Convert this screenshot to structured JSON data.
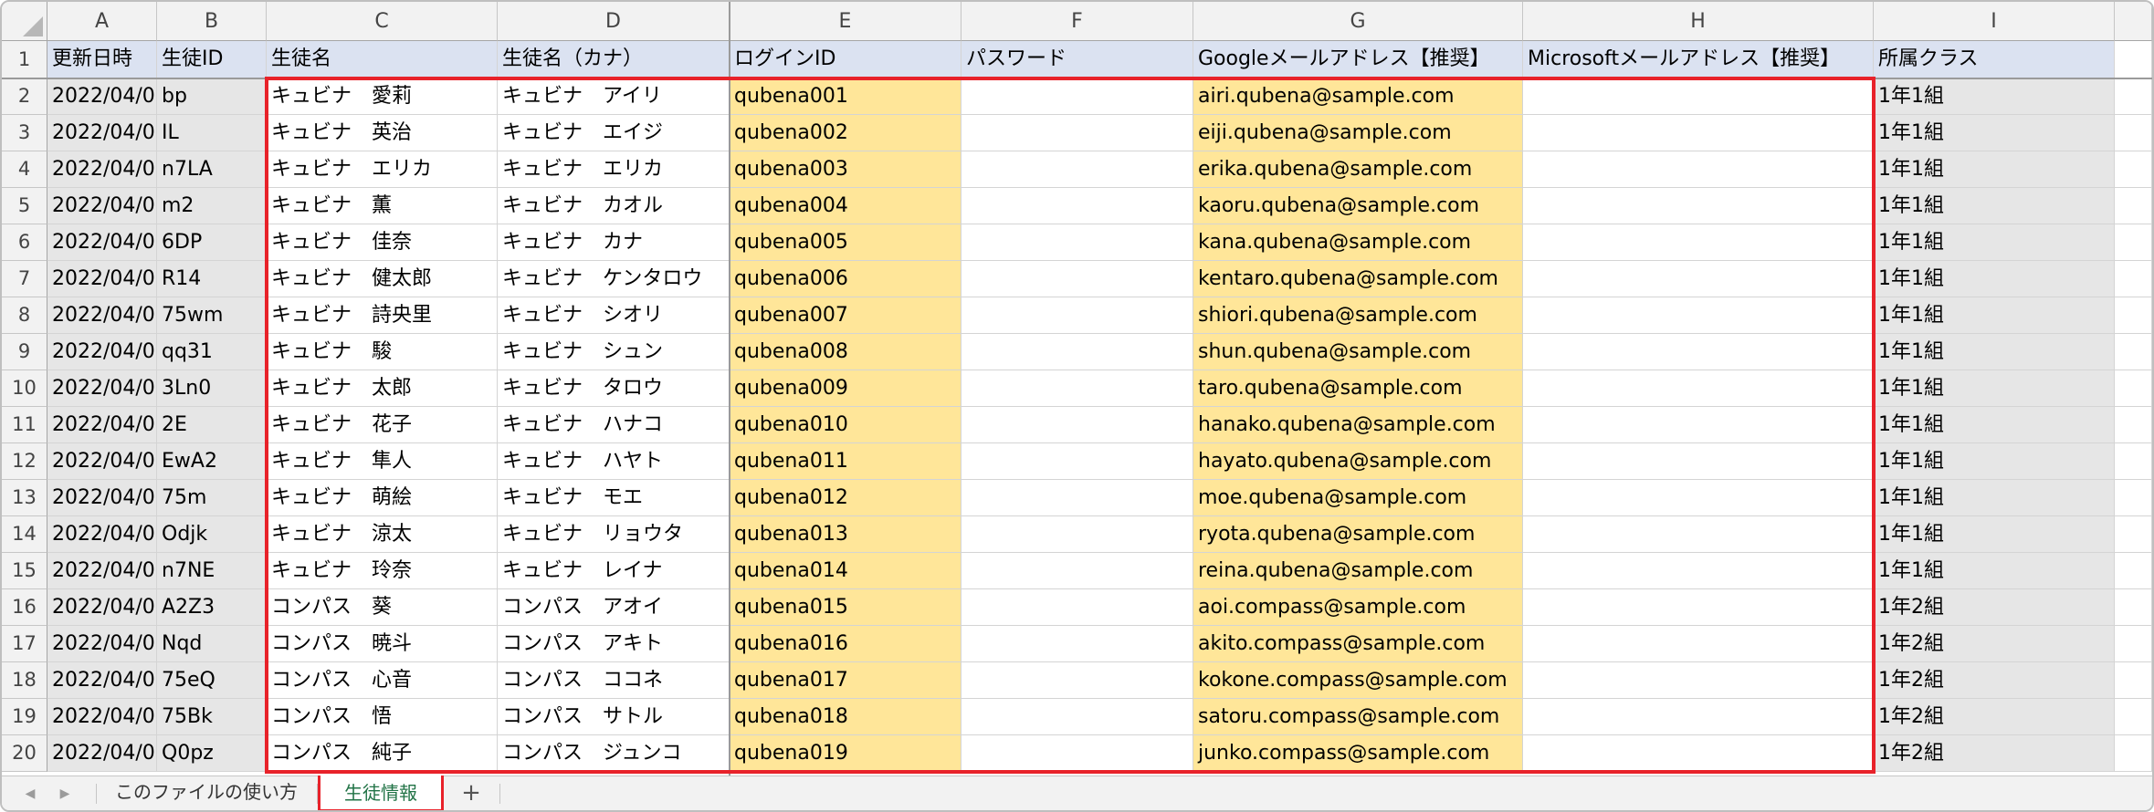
{
  "columns": [
    "A",
    "B",
    "C",
    "D",
    "E",
    "F",
    "G",
    "H",
    "I"
  ],
  "header_row": {
    "row_number": "1",
    "cells": [
      "更新日時",
      "生徒ID",
      "生徒名",
      "生徒名（カナ）",
      "ログインID",
      "パスワード",
      "Googleメールアドレス【推奨】",
      "Microsoftメールアドレス【推奨】",
      "所属クラス"
    ]
  },
  "rows": [
    {
      "n": "2",
      "cells": [
        "2022/04/0",
        "bp",
        "キュビナ　愛莉",
        "キュビナ　アイリ",
        "qubena001",
        "",
        "airi.qubena@sample.com",
        "",
        "1年1組"
      ]
    },
    {
      "n": "3",
      "cells": [
        "2022/04/0",
        "IL",
        "キュビナ　英治",
        "キュビナ　エイジ",
        "qubena002",
        "",
        "eiji.qubena@sample.com",
        "",
        "1年1組"
      ]
    },
    {
      "n": "4",
      "cells": [
        "2022/04/0",
        "n7LA",
        "キュビナ　エリカ",
        "キュビナ　エリカ",
        "qubena003",
        "",
        "erika.qubena@sample.com",
        "",
        "1年1組"
      ]
    },
    {
      "n": "5",
      "cells": [
        "2022/04/0",
        "m2",
        "キュビナ　薫",
        "キュビナ　カオル",
        "qubena004",
        "",
        "kaoru.qubena@sample.com",
        "",
        "1年1組"
      ]
    },
    {
      "n": "6",
      "cells": [
        "2022/04/0",
        "6DP",
        "キュビナ　佳奈",
        "キュビナ　カナ",
        "qubena005",
        "",
        "kana.qubena@sample.com",
        "",
        "1年1組"
      ]
    },
    {
      "n": "7",
      "cells": [
        "2022/04/0",
        "R14",
        "キュビナ　健太郎",
        "キュビナ　ケンタロウ",
        "qubena006",
        "",
        "kentaro.qubena@sample.com",
        "",
        "1年1組"
      ]
    },
    {
      "n": "8",
      "cells": [
        "2022/04/0",
        "75wm",
        "キュビナ　詩央里",
        "キュビナ　シオリ",
        "qubena007",
        "",
        "shiori.qubena@sample.com",
        "",
        "1年1組"
      ]
    },
    {
      "n": "9",
      "cells": [
        "2022/04/0",
        "qq31",
        "キュビナ　駿",
        "キュビナ　シュン",
        "qubena008",
        "",
        "shun.qubena@sample.com",
        "",
        "1年1組"
      ]
    },
    {
      "n": "10",
      "cells": [
        "2022/04/0",
        "3Ln0",
        "キュビナ　太郎",
        "キュビナ　タロウ",
        "qubena009",
        "",
        "taro.qubena@sample.com",
        "",
        "1年1組"
      ]
    },
    {
      "n": "11",
      "cells": [
        "2022/04/0",
        "2E",
        "キュビナ　花子",
        "キュビナ　ハナコ",
        "qubena010",
        "",
        "hanako.qubena@sample.com",
        "",
        "1年1組"
      ]
    },
    {
      "n": "12",
      "cells": [
        "2022/04/0",
        "EwA2",
        "キュビナ　隼人",
        "キュビナ　ハヤト",
        "qubena011",
        "",
        "hayato.qubena@sample.com",
        "",
        "1年1組"
      ]
    },
    {
      "n": "13",
      "cells": [
        "2022/04/0",
        "75m",
        "キュビナ　萌絵",
        "キュビナ　モエ",
        "qubena012",
        "",
        "moe.qubena@sample.com",
        "",
        "1年1組"
      ]
    },
    {
      "n": "14",
      "cells": [
        "2022/04/0",
        "Odjk",
        "キュビナ　涼太",
        "キュビナ　リョウタ",
        "qubena013",
        "",
        "ryota.qubena@sample.com",
        "",
        "1年1組"
      ]
    },
    {
      "n": "15",
      "cells": [
        "2022/04/0",
        "n7NE",
        "キュビナ　玲奈",
        "キュビナ　レイナ",
        "qubena014",
        "",
        "reina.qubena@sample.com",
        "",
        "1年1組"
      ]
    },
    {
      "n": "16",
      "cells": [
        "2022/04/0",
        "A2Z3",
        "コンパス　葵",
        "コンパス　アオイ",
        "qubena015",
        "",
        "aoi.compass@sample.com",
        "",
        "1年2組"
      ]
    },
    {
      "n": "17",
      "cells": [
        "2022/04/0",
        "Nqd",
        "コンパス　暁斗",
        "コンパス　アキト",
        "qubena016",
        "",
        "akito.compass@sample.com",
        "",
        "1年2組"
      ]
    },
    {
      "n": "18",
      "cells": [
        "2022/04/0",
        "75eQ",
        "コンパス　心音",
        "コンパス　ココネ",
        "qubena017",
        "",
        "kokone.compass@sample.com",
        "",
        "1年2組"
      ]
    },
    {
      "n": "19",
      "cells": [
        "2022/04/0",
        "75Bk",
        "コンパス　悟",
        "コンパス　サトル",
        "qubena018",
        "",
        "satoru.compass@sample.com",
        "",
        "1年2組"
      ]
    },
    {
      "n": "20",
      "cells": [
        "2022/04/0",
        "Q0pz",
        "コンパス　純子",
        "コンパス　ジュンコ",
        "qubena019",
        "",
        "junko.compass@sample.com",
        "",
        "1年2組"
      ]
    }
  ],
  "sheet_tabs": {
    "tabs": [
      "このファイルの使い方",
      "生徒情報"
    ],
    "active_index": 1,
    "add_label": "+",
    "prev_icon": "◀",
    "next_icon": "▶"
  },
  "colors": {
    "header_fill": "#dbe2f1",
    "grey_fill": "#e6e6e6",
    "yellow_fill": "#ffe699",
    "highlight_border": "#e8222a",
    "active_tab_text": "#217346"
  },
  "column_fills": [
    "grey",
    "grey",
    "white",
    "white",
    "yellow",
    "white",
    "yellow",
    "white",
    "grey"
  ],
  "comment_marker_columns": [
    1,
    4,
    5,
    8
  ]
}
